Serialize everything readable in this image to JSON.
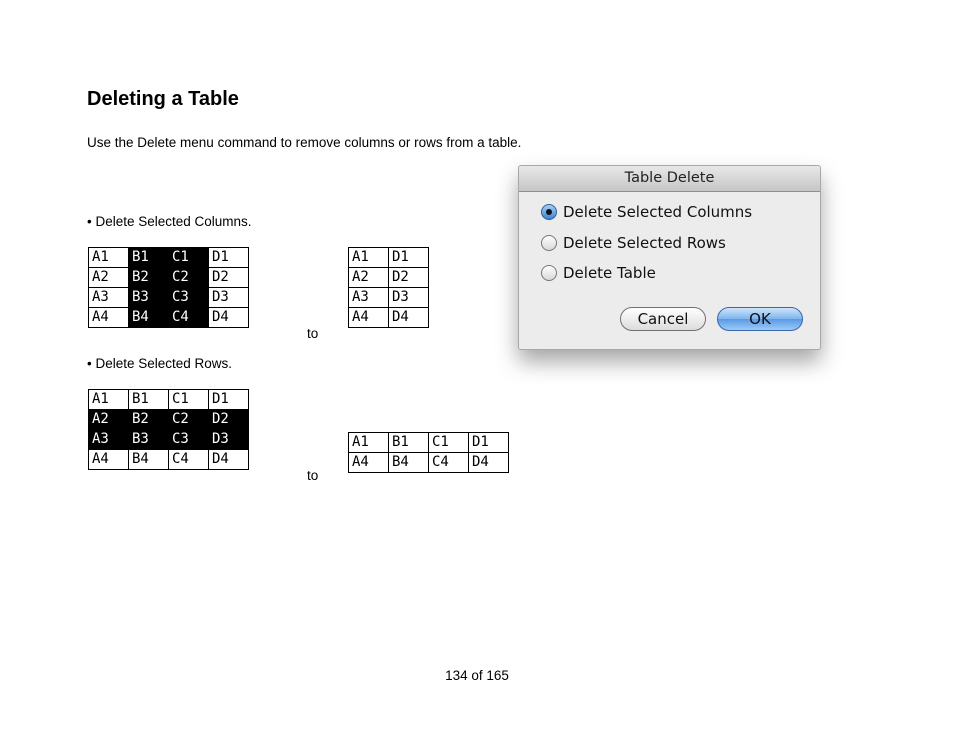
{
  "page": {
    "title": "Deleting a Table",
    "intro": "Use the Delete menu command to remove columns or rows from a table.",
    "page_number": "134 of 165"
  },
  "section_columns": {
    "bullet": "• Delete Selected Columns.",
    "to_label": "to",
    "before_rows": [
      [
        "A1",
        "B1",
        "C1",
        "D1"
      ],
      [
        "A2",
        "B2",
        "C2",
        "D2"
      ],
      [
        "A3",
        "B3",
        "C3",
        "D3"
      ],
      [
        "A4",
        "B4",
        "C4",
        "D4"
      ]
    ],
    "selected_columns": [
      1,
      2
    ],
    "after_rows": [
      [
        "A1",
        "D1"
      ],
      [
        "A2",
        "D2"
      ],
      [
        "A3",
        "D3"
      ],
      [
        "A4",
        "D4"
      ]
    ]
  },
  "section_rows": {
    "bullet": "• Delete Selected Rows.",
    "to_label": "to",
    "before_rows": [
      [
        "A1",
        "B1",
        "C1",
        "D1"
      ],
      [
        "A2",
        "B2",
        "C2",
        "D2"
      ],
      [
        "A3",
        "B3",
        "C3",
        "D3"
      ],
      [
        "A4",
        "B4",
        "C4",
        "D4"
      ]
    ],
    "selected_rows": [
      1,
      2
    ],
    "after_rows": [
      [
        "A1",
        "B1",
        "C1",
        "D1"
      ],
      [
        "A4",
        "B4",
        "C4",
        "D4"
      ]
    ]
  },
  "dialog": {
    "title": "Table Delete",
    "options": [
      {
        "label": "Delete Selected Columns",
        "selected": true
      },
      {
        "label": "Delete Selected Rows",
        "selected": false
      },
      {
        "label": "Delete Table",
        "selected": false
      }
    ],
    "cancel_label": "Cancel",
    "ok_label": "OK"
  }
}
